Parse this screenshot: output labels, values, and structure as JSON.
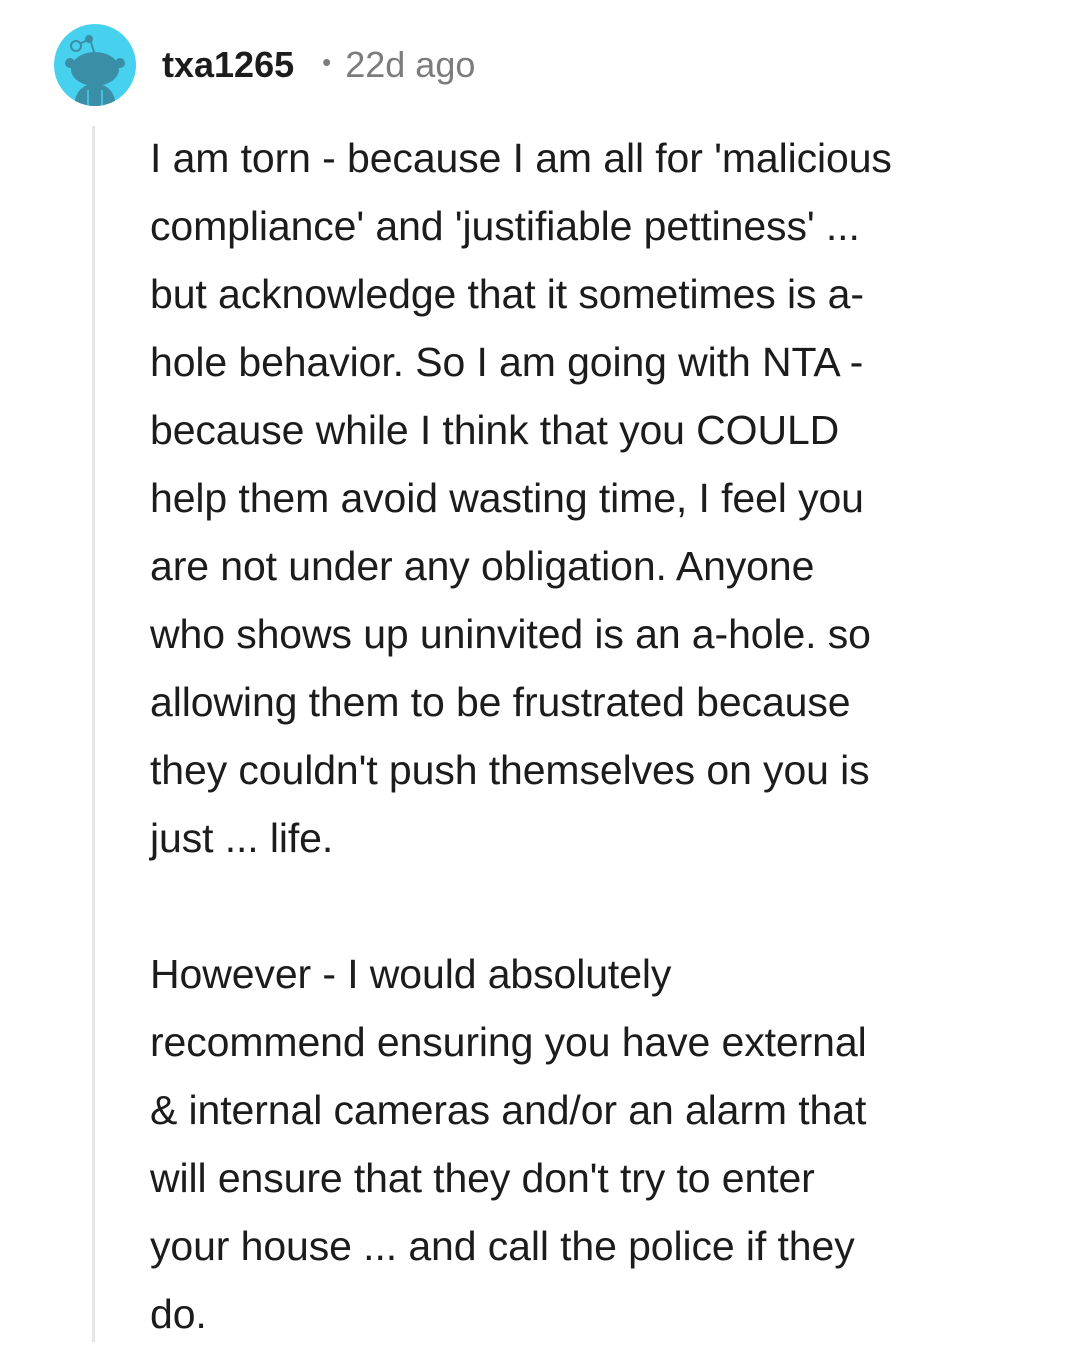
{
  "comment": {
    "avatar_icon": "reddit-snoo-avatar-icon",
    "avatar_color": "#46d1ef",
    "username": "txa1265",
    "separator": "•",
    "timestamp": "22d ago",
    "paragraphs": [
      "I am torn - because I am all for 'malicious\ncompliance' and 'justifiable pettiness' ...\nbut acknowledge that it sometimes is a-\nhole behavior. So I am going with NTA -\nbecause while I think that you COULD\nhelp them avoid wasting time, I feel you\nare not under any obligation. Anyone\nwho shows up uninvited is an a-hole. so\nallowing them to be frustrated because\nthey couldn't push themselves on you is\njust ... life.",
      "However - I would absolutely\nrecommend ensuring you have external\n& internal cameras and/or an alarm that\nwill ensure that they don't try to enter\nyour house ... and call the police if they\ndo."
    ]
  }
}
